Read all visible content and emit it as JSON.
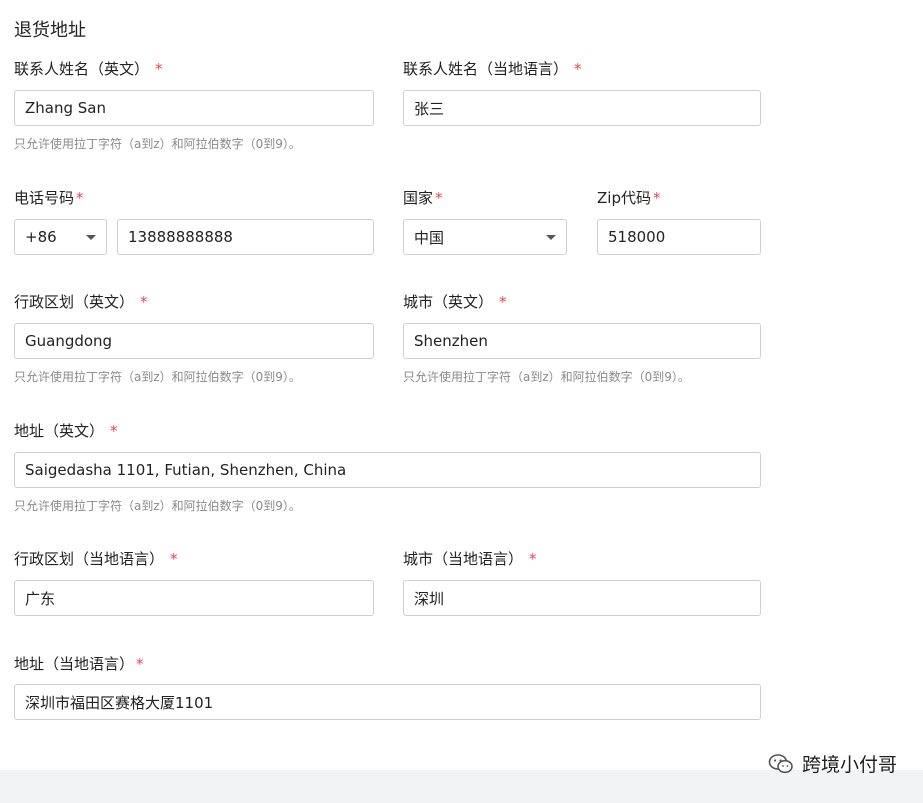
{
  "section_title": "退货地址",
  "fields": {
    "contact_name_en": {
      "label": "联系人姓名（英文）",
      "value": "Zhang San"
    },
    "contact_name_local": {
      "label": "联系人姓名（当地语言）",
      "value": "张三"
    },
    "phone": {
      "label": "电话号码",
      "country_code": "+86",
      "number": "13888888888"
    },
    "country": {
      "label": "国家",
      "value": "中国"
    },
    "zip": {
      "label": "Zip代码",
      "value": "518000"
    },
    "region_en": {
      "label": "行政区划（英文）",
      "value": "Guangdong"
    },
    "city_en": {
      "label": "城市（英文）",
      "value": "Shenzhen"
    },
    "address_en": {
      "label": "地址（英文）",
      "value": "Saigedasha 1101, Futian, Shenzhen, China"
    },
    "region_local": {
      "label": "行政区划（当地语言）",
      "value": "广东"
    },
    "city_local": {
      "label": "城市（当地语言）",
      "value": "深圳"
    },
    "address_local": {
      "label": "地址（当地语言）",
      "value": "深圳市福田区赛格大厦1101"
    }
  },
  "hint_text": "只允许使用拉丁字符（a到z）和阿拉伯数字（0到9）。",
  "required_mark": "*",
  "watermark": {
    "text": "跨境小付哥",
    "icon": "wechat-icon"
  },
  "colors": {
    "required": "#e5484d",
    "hint": "#8a8a8a",
    "border": "#cfcfcf"
  }
}
